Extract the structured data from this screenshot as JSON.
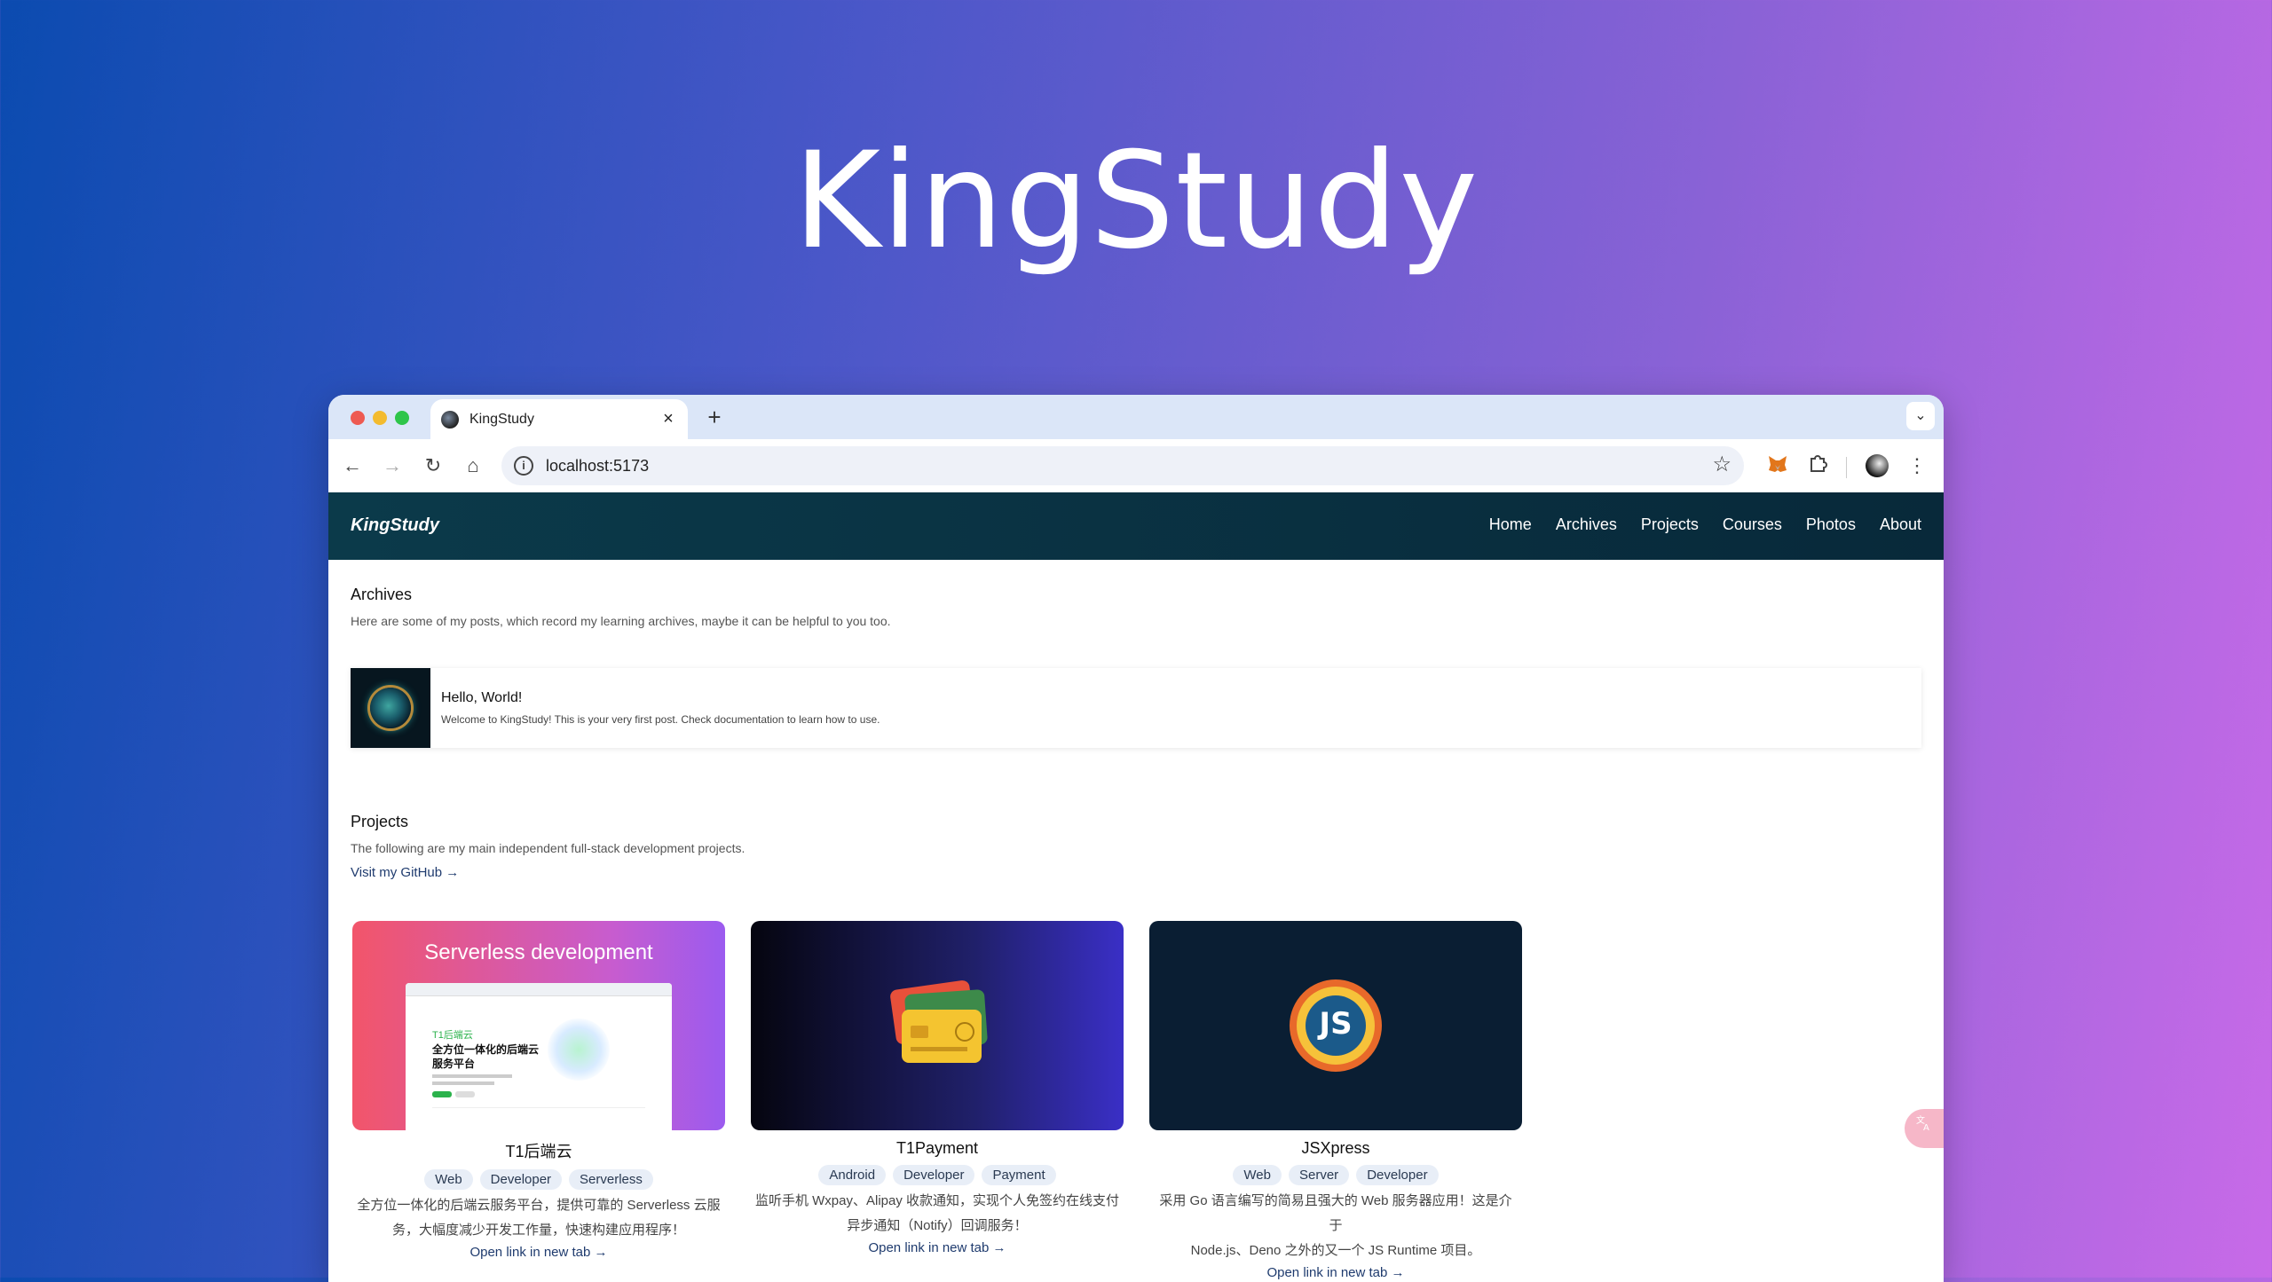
{
  "hero": {
    "title": "KingStudy"
  },
  "browser": {
    "tab_title": "KingStudy",
    "tab_close": "×",
    "new_tab": "+",
    "url": "localhost:5173"
  },
  "site": {
    "brand": "KingStudy",
    "nav": [
      "Home",
      "Archives",
      "Projects",
      "Courses",
      "Photos",
      "About"
    ]
  },
  "archives": {
    "title": "Archives",
    "description": "Here are some of my posts, which record my learning archives, maybe it can be helpful to you too.",
    "posts": [
      {
        "title": "Hello, World!",
        "excerpt": "Welcome to KingStudy! This is your very first post. Check documentation to learn how to use."
      }
    ]
  },
  "projects": {
    "title": "Projects",
    "description": "The following are my main independent full-stack development projects.",
    "github_link": "Visit my GitHub →",
    "items": [
      {
        "name": "T1后端云",
        "tags": [
          "Web",
          "Developer",
          "Serverless"
        ],
        "desc1": "全方位一体化的后端云服务平台，提供可靠的 Serverless 云服",
        "desc2": "务，大幅度减少开发工作量，快速构建应用程序！",
        "link": "Open link in new tab →",
        "image_caption": "Serverless development",
        "mock_title": "T1后端云",
        "mock_heading1": "全方位一体化的后端云",
        "mock_heading2": "服务平台"
      },
      {
        "name": "T1Payment",
        "tags": [
          "Android",
          "Developer",
          "Payment"
        ],
        "desc1": "监听手机 Wxpay、Alipay 收款通知，实现个人免签约在线支付",
        "desc2": "异步通知（Notify）回调服务！",
        "link": "Open link in new tab →"
      },
      {
        "name": "JSXpress",
        "tags": [
          "Web",
          "Server",
          "Developer"
        ],
        "desc1": "采用 Go 语言编写的简易且强大的 Web 服务器应用！这是介于",
        "desc2": "Node.js、Deno 之外的又一个 JS Runtime 项目。",
        "link": "Open link in new tab →",
        "logo_text": "JS"
      }
    ]
  },
  "colors": {
    "nav_bg": "#0b3a4a",
    "accent_link": "#1f3b6e"
  }
}
